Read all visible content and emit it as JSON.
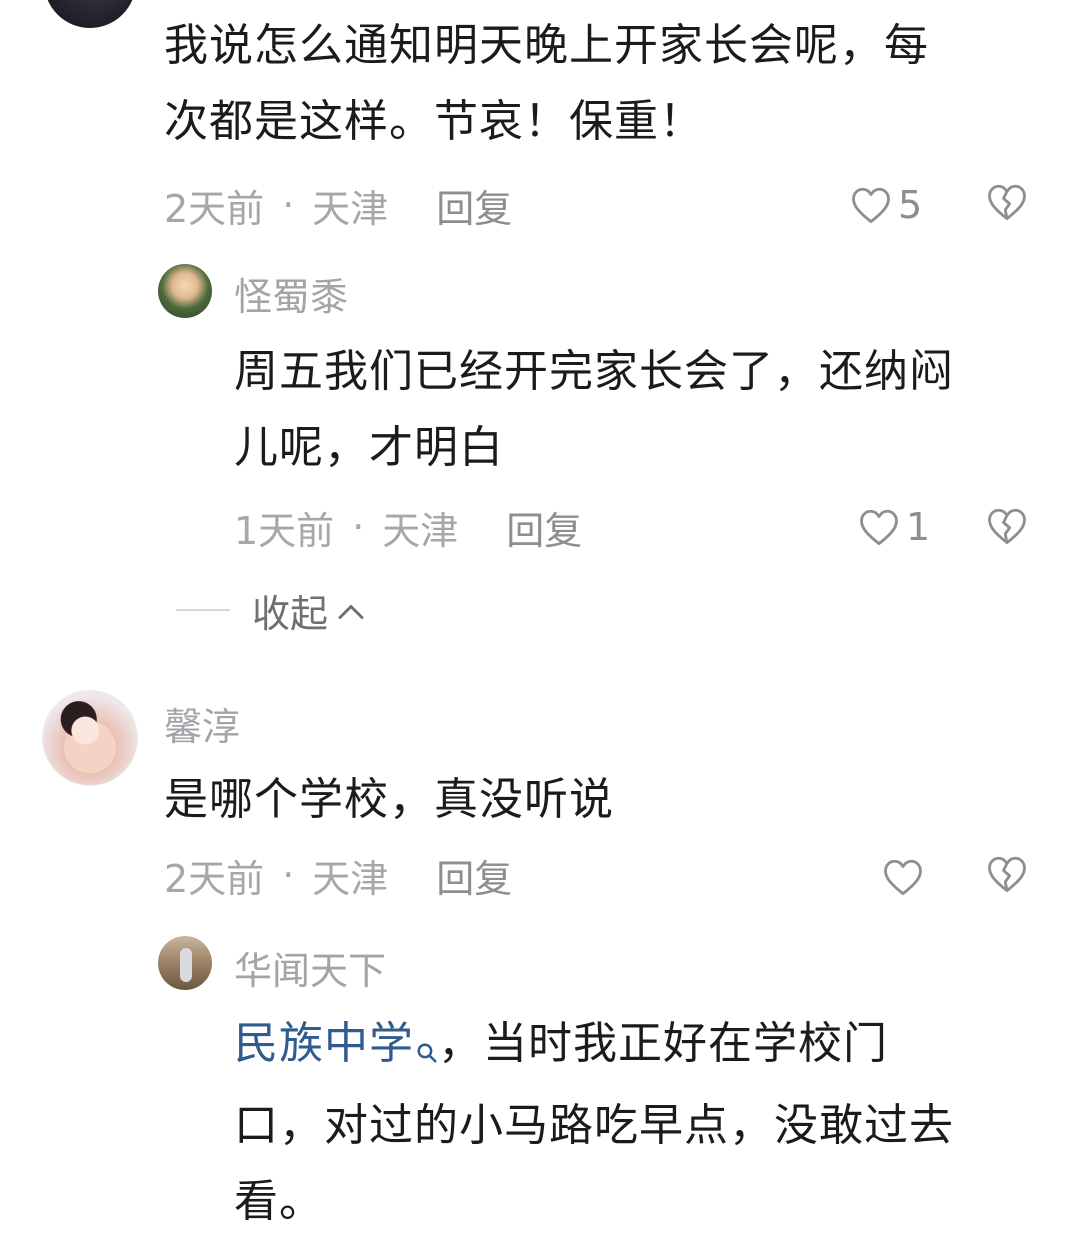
{
  "comments": [
    {
      "text": "我说怎么通知明天晚上开家长会呢，每次都是这样。节哀！保重！",
      "line1": "我说怎么通知明天晚上开家长会呢，每",
      "line2": "次都是这样。节哀！保重！",
      "time": "2天前",
      "dot": "·",
      "location": "天津",
      "reply_label": "回复",
      "likes": "5",
      "replies": [
        {
          "username": "怪蜀黍",
          "line1": "周五我们已经开完家长会了，还纳闷",
          "line2": "儿呢，才明白",
          "time": "1天前",
          "dot": "·",
          "location": "天津",
          "reply_label": "回复",
          "likes": "1"
        }
      ],
      "collapse_label": "收起"
    },
    {
      "username": "馨淳",
      "text": "是哪个学校，真没听说",
      "time": "2天前",
      "dot": "·",
      "location": "天津",
      "reply_label": "回复",
      "likes": "",
      "replies": [
        {
          "username": "华闻天下",
          "link_text": "民族中学",
          "line1_rest": "，当时我正好在学校门",
          "line2": "口，对过的小马路吃早点，没敢过去",
          "line3": "看。"
        }
      ]
    }
  ],
  "icons": {
    "like": "heart-outline-icon",
    "dislike": "broken-heart-icon",
    "search": "search-icon",
    "collapse": "chevron-up-icon"
  },
  "colors": {
    "text": "#1b1b1b",
    "meta": "#a7a7ab",
    "link": "#2f5b8f"
  }
}
